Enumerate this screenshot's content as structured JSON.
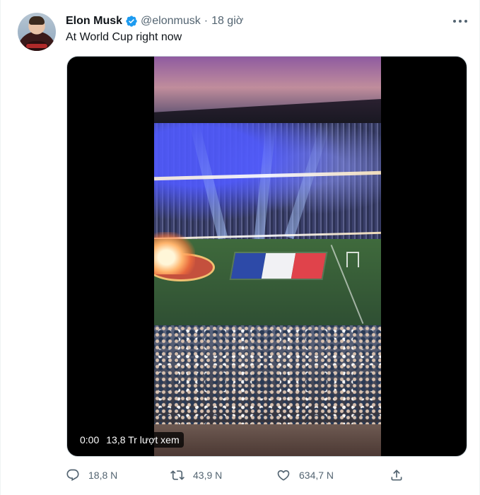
{
  "tweet": {
    "author": {
      "display_name": "Elon Musk",
      "handle": "@elonmusk",
      "verified": true
    },
    "separator": "·",
    "timestamp": "18 giờ",
    "text": "At World Cup right now",
    "video": {
      "current_time": "0:00",
      "views": "13,8 Tr lượt xem"
    },
    "actions": {
      "reply_count": "18,8 N",
      "retweet_count": "43,9 N",
      "like_count": "634,7 N"
    }
  },
  "icons": {
    "more": "more-horizontal-icon",
    "verified": "verified-badge-icon",
    "reply": "reply-icon",
    "retweet": "retweet-icon",
    "like": "heart-icon",
    "share": "share-icon"
  },
  "colors": {
    "verified_blue": "#1d9bf0",
    "secondary_text": "#536471",
    "primary_text": "#0f1419",
    "flag_blue": "#2d4aa8",
    "flag_white": "#f1f1f4",
    "flag_red": "#e0434b"
  }
}
